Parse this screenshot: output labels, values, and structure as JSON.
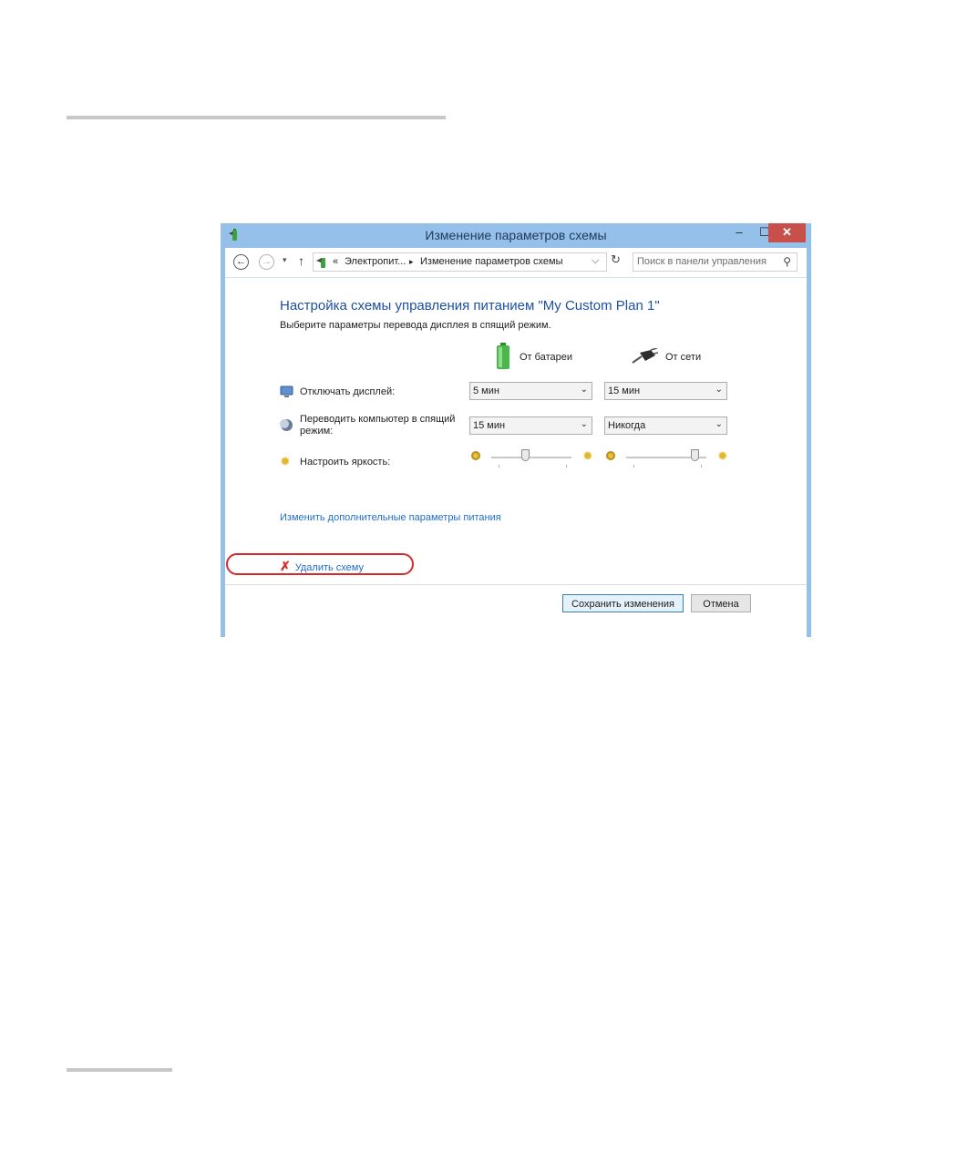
{
  "window": {
    "title": "Изменение параметров схемы",
    "controls": {
      "minimize": "–",
      "maximize": "☐",
      "close": "✕"
    }
  },
  "addressbar": {
    "breadcrumb_sep": "«",
    "crumb1": "Электропит...",
    "crumb_arrow": "▸",
    "crumb2": "Изменение параметров схемы",
    "search_placeholder": "Поиск в панели управления"
  },
  "content": {
    "title": "Настройка схемы управления питанием \"My Custom Plan 1\"",
    "subtitle": "Выберите параметры перевода дисплея в спящий режим.",
    "columns": {
      "battery": "От батареи",
      "ac": "От сети"
    },
    "rows": {
      "display_off": {
        "label": "Отключать дисплей:",
        "battery": "5 мин",
        "ac": "15 мин"
      },
      "sleep": {
        "label_line1": "Переводить компьютер в спящий",
        "label_line2": "режим:",
        "battery": "15 мин",
        "ac": "Никогда"
      },
      "brightness": {
        "label": "Настроить яркость:",
        "battery_level": 0.42,
        "ac_level": 0.85
      }
    },
    "advanced_link": "Изменить дополнительные параметры питания",
    "delete_link": "Удалить схему"
  },
  "buttons": {
    "save": "Сохранить изменения",
    "cancel": "Отмена"
  },
  "colors": {
    "titlebar": "#94c0ea",
    "close": "#c7504a",
    "link": "#1e6ec8",
    "highlight": "#d42a2a"
  }
}
